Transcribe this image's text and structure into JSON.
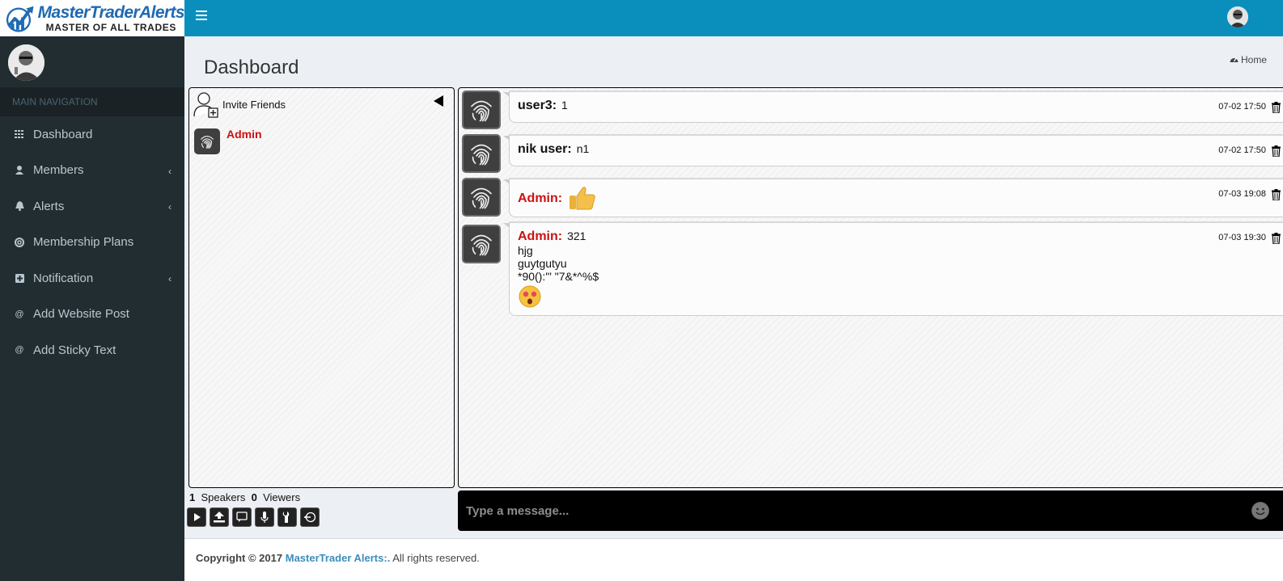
{
  "brand": {
    "name": "MasterTraderAlerts",
    "tagline": "MASTER OF ALL TRADES"
  },
  "header": {
    "page_title": "Dashboard",
    "breadcrumb_home": "Home"
  },
  "sidebar": {
    "section_header": "MAIN NAVIGATION",
    "items": [
      {
        "label": "Dashboard",
        "icon": "grid-icon",
        "has_submenu": false
      },
      {
        "label": "Members",
        "icon": "user-icon",
        "has_submenu": true
      },
      {
        "label": "Alerts",
        "icon": "bell-icon",
        "has_submenu": true
      },
      {
        "label": "Membership Plans",
        "icon": "life-ring-icon",
        "has_submenu": false
      },
      {
        "label": "Notification",
        "icon": "plus-square-icon",
        "has_submenu": true
      },
      {
        "label": "Add Website Post",
        "icon": "at-icon",
        "has_submenu": false
      },
      {
        "label": "Add Sticky Text",
        "icon": "at-icon",
        "has_submenu": false
      }
    ]
  },
  "room": {
    "invite_label": "Invite Friends",
    "users": [
      {
        "name": "Admin"
      }
    ],
    "speakers_count": "1",
    "speakers_label": "Speakers",
    "viewers_count": "0",
    "viewers_label": "Viewers",
    "toolbar_icons": [
      "play-icon",
      "upload-icon",
      "chat-bubble-icon",
      "microphone-icon",
      "wrench-icon",
      "logout-icon"
    ]
  },
  "chat": {
    "messages": [
      {
        "user": "user3:",
        "text": "1",
        "time": "07-02 17:50",
        "admin": false
      },
      {
        "user": "nik user:",
        "text": "n1",
        "time": "07-02 17:50",
        "admin": false
      },
      {
        "user": "Admin:",
        "text": "",
        "emoji": "thumbs-up-icon",
        "time": "07-03 19:08",
        "admin": true
      },
      {
        "user": "Admin:",
        "text": "321",
        "lines": [
          "hjg",
          "guytgutyu",
          "*90():'\" \"7&*^%$"
        ],
        "emoji": "love-struck-emoji-icon",
        "time": "07-03 19:30",
        "admin": true
      }
    ],
    "placeholder": "Type a message..."
  },
  "footer": {
    "copyright": "Copyright © 2017",
    "brand_link": "MasterTrader Alerts:.",
    "rights": "All rights reserved."
  },
  "colors": {
    "header": "#0a8fbc",
    "sidebar": "#222d32",
    "admin_red": "#cc1111",
    "link_blue": "#3c8dbc"
  }
}
